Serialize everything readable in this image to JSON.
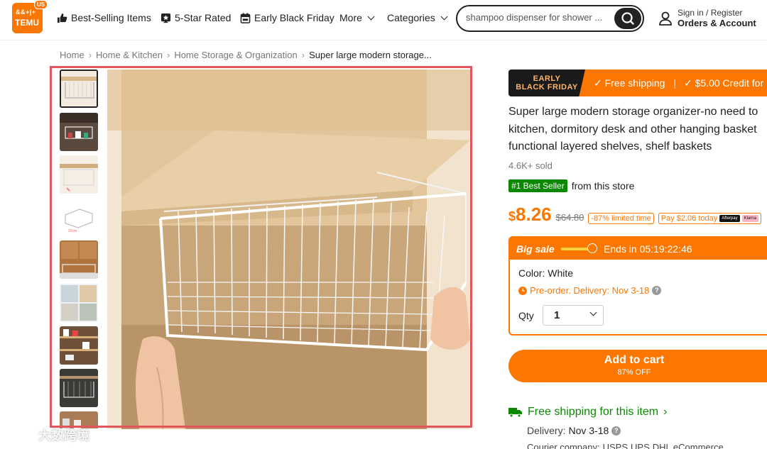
{
  "header": {
    "logo_name": "TEMU",
    "logo_top": "&&+|+",
    "logo_region": "US",
    "nav": [
      "Best-Selling Items",
      "5-Star Rated",
      "Early Black Friday",
      "More",
      "Categories"
    ],
    "search_value": "shampoo dispenser for shower ...",
    "signin_line1": "Sign in / Register",
    "signin_line2": "Orders & Account"
  },
  "breadcrumb": [
    "Home",
    "Home & Kitchen",
    "Home Storage & Organization",
    "Super large modern storage..."
  ],
  "promo": {
    "banner_line1": "EARLY",
    "banner_line2": "BLACK FRIDAY",
    "free_shipping": "Free shipping",
    "credit": "$5.00 Credit for"
  },
  "product": {
    "title_lines": [
      "Super large modern storage organizer-no need to",
      "kitchen, dormitory desk and other hanging basket",
      "functional layered shelves, shelf baskets"
    ],
    "sold": "4.6K+ sold",
    "badge": "#1 Best Seller",
    "badge_suffix": "from this store",
    "currency": "$",
    "price": "8.26",
    "old_price": "$64.80",
    "discount_tag": "-87% limited time",
    "pay_today": "Pay $2.06 today",
    "pay_logo_1": "Afterpay",
    "pay_logo_2": "Klarna"
  },
  "sale": {
    "label": "Big sale",
    "ends": "Ends in 05:19:22:46",
    "color": "Color: White",
    "preorder": "Pre-order. Delivery: Nov 3-18",
    "qty_label": "Qty",
    "qty_value": "1"
  },
  "cart": {
    "label": "Add to cart",
    "sub": "87% OFF"
  },
  "shipping": {
    "title": "Free shipping for this item",
    "delivery_label": "Delivery:",
    "delivery_value": "Nov 3-18",
    "courier": "Courier company:",
    "couriers": [
      "USPS",
      "UPS",
      "DHL eCommerce"
    ]
  },
  "watermark": "大数跨境",
  "colors": {
    "brand": "#fb7701",
    "green": "#0a8800",
    "highlight": "#e0575b"
  }
}
